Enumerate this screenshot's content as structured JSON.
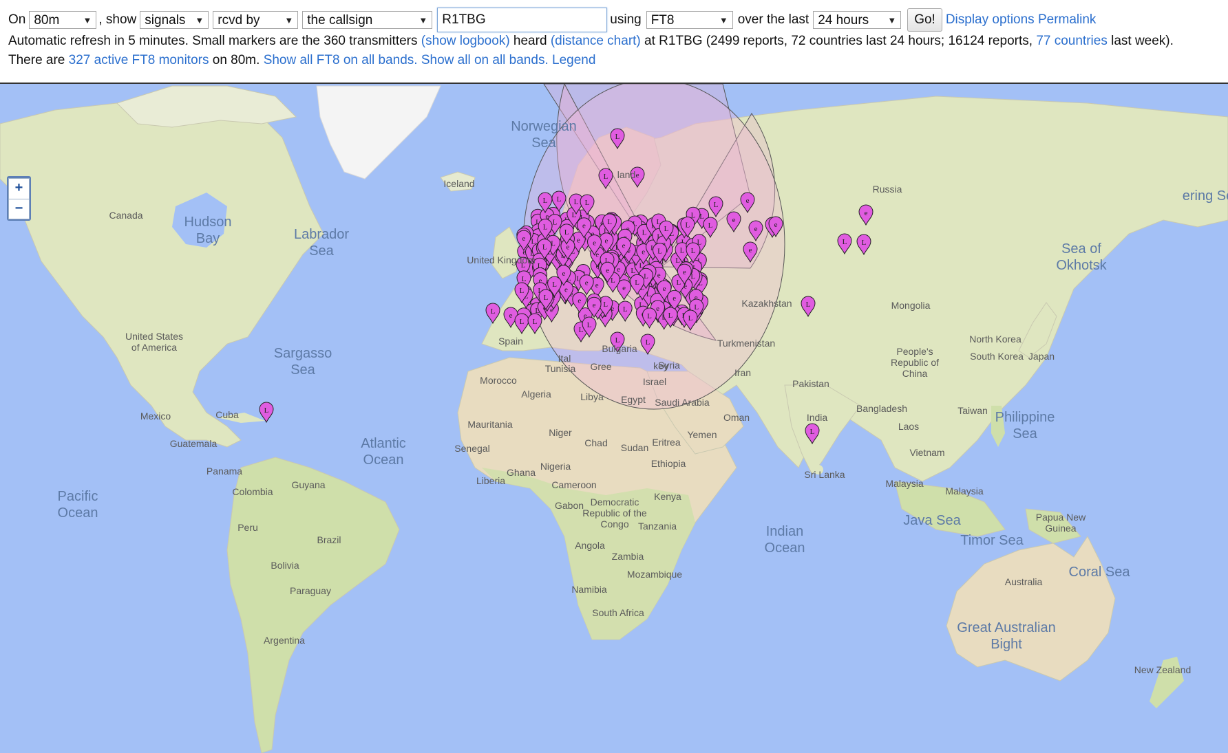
{
  "controls": {
    "on_label": "On",
    "band": "80m",
    "show_label": ", show",
    "show_what": "signals",
    "direction": "rcvd by",
    "target_type": "the callsign",
    "callsign": "R1TBG",
    "using_label": "using",
    "mode": "FT8",
    "over_label": "over the last",
    "period": "24 hours",
    "go_label": "Go!",
    "display_options": "Display options",
    "permalink": "Permalink"
  },
  "info": {
    "line1_a": "Automatic refresh in 5 minutes. Small markers are the 360 transmitters",
    "show_logbook": "(show logbook)",
    "line1_b": "heard",
    "distance_chart": "(distance chart)",
    "line1_c": "at R1TBG (2499 reports, 72 countries last 24 hours; 16124 reports,",
    "countries_link": "77 countries",
    "line1_d": "last week).",
    "line2_a": "There are",
    "active_monitors": "327 active FT8 monitors",
    "line2_b": "on 80m.",
    "show_all_ft8": "Show all FT8 on all bands.",
    "show_all": "Show all on all bands.",
    "legend": "Legend"
  },
  "map": {
    "zoom_in": "+",
    "zoom_out": "−",
    "marker_color": "#e05ce0",
    "land_color": "#d9e4b8",
    "water_color": "#a3c0f6",
    "ice_color": "#f3f3f3",
    "labels": {
      "norwegian_sea": "Norwegian Sea",
      "iceland": "Iceland",
      "canada": "Canada",
      "hudson_bay": "Hudson Bay",
      "labrador_sea": "Labrador Sea",
      "united_states": "United States of America",
      "sargasso_sea": "Sargasso Sea",
      "mexico": "Mexico",
      "cuba": "Cuba",
      "guatemala": "Guatemala",
      "panama": "Panama",
      "pacific_ocean": "Pacific Ocean",
      "atlantic_ocean": "Atlantic Ocean",
      "colombia": "Colombia",
      "guyana": "Guyana",
      "peru": "Peru",
      "brazil": "Brazil",
      "bolivia": "Bolivia",
      "paraguay": "Paraguay",
      "argentina": "Argentina",
      "russia": "Russia",
      "sea_of_okhotsk": "Sea of Okhotsk",
      "bering_sea": "ering Se",
      "kazakhstan": "Kazakhstan",
      "mongolia": "Mongolia",
      "turkmenistan": "Turkmenistan",
      "iran": "Iran",
      "pakistan": "Pakistan",
      "china": "People's Republic of China",
      "north_korea": "North Korea",
      "south_korea": "South Korea",
      "japan": "Japan",
      "taiwan": "Taiwan",
      "philippine_sea": "Philippine Sea",
      "india": "India",
      "bangladesh": "Bangladesh",
      "laos": "Laos",
      "vietnam": "Vietnam",
      "sri_lanka": "Sri Lanka",
      "malaysia1": "Malaysia",
      "malaysia2": "Malaysia",
      "java_sea": "Java Sea",
      "timor_sea": "Timor Sea",
      "png": "Papua New Guinea",
      "coral_sea": "Coral Sea",
      "australia": "Australia",
      "great_australian_bight": "Great Australian Bight",
      "new_zealand": "New Zealand",
      "indian_ocean": "Indian Ocean",
      "united_kingdom": "United Kingdom",
      "spain": "Spain",
      "morocco": "Morocco",
      "tunisia": "Tunisia",
      "algeria": "Algeria",
      "libya": "Libya",
      "egypt": "Egypt",
      "saudi_arabia": "Saudi Arabia",
      "oman": "Oman",
      "yemen": "Yemen",
      "syria": "Syria",
      "israel": "Israel",
      "mauritania": "Mauritania",
      "senegal": "Senegal",
      "niger": "Niger",
      "chad": "Chad",
      "sudan": "Sudan",
      "eritrea": "Eritrea",
      "ethiopia": "Ethiopia",
      "ghana": "Ghana",
      "nigeria": "Nigeria",
      "liberia": "Liberia",
      "cameroon": "Cameroon",
      "gabon": "Gabon",
      "drc": "Democratic Republic of the Congo",
      "kenya": "Kenya",
      "tanzania": "Tanzania",
      "angola": "Angola",
      "zambia": "Zambia",
      "mozambique": "Mozambique",
      "namibia": "Namibia",
      "south_africa": "South Africa",
      "italy": "Ital",
      "greece": "Gree",
      "turkey": "key",
      "bulgaria": "Bulgaria",
      "finland": "land"
    }
  }
}
